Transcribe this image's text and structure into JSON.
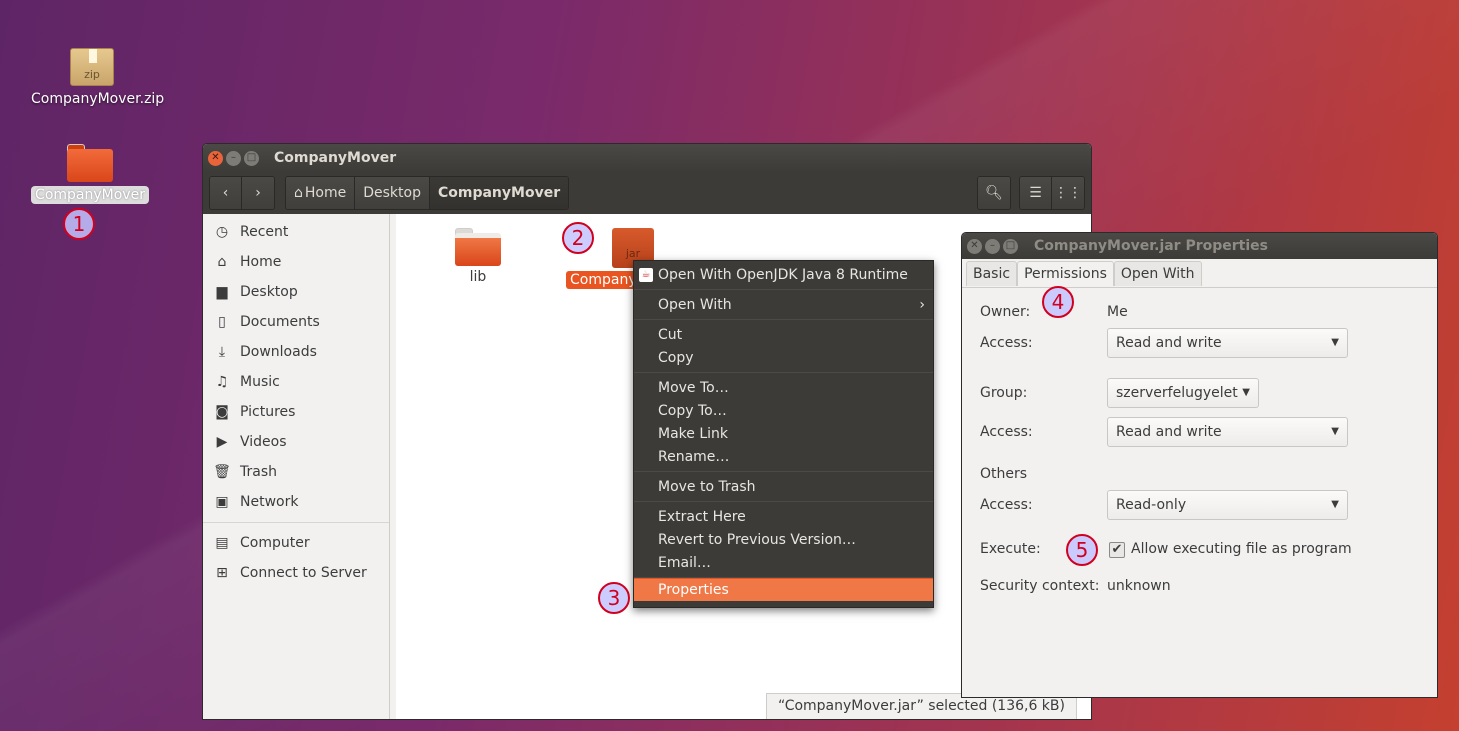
{
  "desktop": {
    "icons": [
      {
        "label": "CompanyMover.zip",
        "kind": "zip",
        "badge": "zip"
      },
      {
        "label": "CompanyMover",
        "kind": "folder"
      }
    ]
  },
  "annotations": [
    "1",
    "2",
    "3",
    "4",
    "5"
  ],
  "file_manager": {
    "title": "CompanyMover",
    "breadcrumbs": [
      "Home",
      "Desktop",
      "CompanyMover"
    ],
    "sidebar": [
      {
        "label": "Recent",
        "icon": "clock-icon"
      },
      {
        "label": "Home",
        "icon": "home-icon"
      },
      {
        "label": "Desktop",
        "icon": "desktop-folder-icon"
      },
      {
        "label": "Documents",
        "icon": "document-icon"
      },
      {
        "label": "Downloads",
        "icon": "download-icon"
      },
      {
        "label": "Music",
        "icon": "music-icon"
      },
      {
        "label": "Pictures",
        "icon": "camera-icon"
      },
      {
        "label": "Videos",
        "icon": "video-icon"
      },
      {
        "label": "Trash",
        "icon": "trash-icon"
      },
      {
        "label": "Network",
        "icon": "network-icon"
      },
      {
        "label": "Computer",
        "icon": "computer-icon"
      },
      {
        "label": "Connect to Server",
        "icon": "server-icon"
      }
    ],
    "files": [
      {
        "label": "lib"
      },
      {
        "label": "Company",
        "badge": "jar"
      }
    ],
    "status": "“CompanyMover.jar” selected  (136,6 kB)"
  },
  "context_menu": {
    "items": [
      {
        "label": "Open With OpenJDK Java 8 Runtime"
      },
      {
        "label": "Open With"
      },
      {
        "label": "Cut"
      },
      {
        "label": "Copy"
      },
      {
        "label": "Move To…"
      },
      {
        "label": "Copy To…"
      },
      {
        "label": "Make Link"
      },
      {
        "label": "Rename…"
      },
      {
        "label": "Move to Trash"
      },
      {
        "label": "Extract Here"
      },
      {
        "label": "Revert to Previous Version…"
      },
      {
        "label": "Email…"
      },
      {
        "label": "Properties"
      }
    ]
  },
  "properties": {
    "title": "CompanyMover.jar Properties",
    "tabs": [
      "Basic",
      "Permissions",
      "Open With"
    ],
    "owner_label": "Owner:",
    "owner_value": "Me",
    "access_label": "Access:",
    "owner_access": "Read and write",
    "group_label": "Group:",
    "group_value": "szerverfelugyelet",
    "group_access": "Read and write",
    "others_label": "Others",
    "others_access": "Read-only",
    "execute_label": "Execute:",
    "execute_option": "Allow executing file as program",
    "execute_checked": true,
    "security_label": "Security context:",
    "security_value": "unknown"
  },
  "colors": {
    "accent": "#e95420",
    "annotation": "#d2001f"
  }
}
